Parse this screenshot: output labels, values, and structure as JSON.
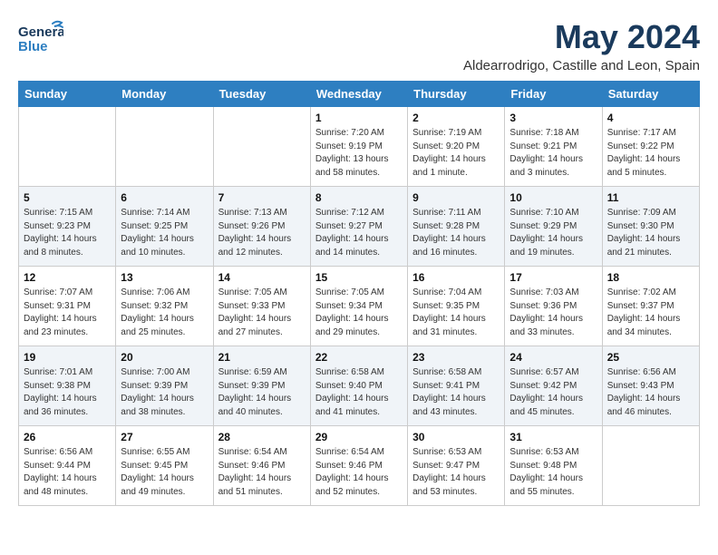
{
  "header": {
    "logo_general": "General",
    "logo_blue": "Blue",
    "month_year": "May 2024",
    "location": "Aldearrodrigo, Castille and Leon, Spain"
  },
  "days_of_week": [
    "Sunday",
    "Monday",
    "Tuesday",
    "Wednesday",
    "Thursday",
    "Friday",
    "Saturday"
  ],
  "weeks": [
    [
      {
        "day": "",
        "info": ""
      },
      {
        "day": "",
        "info": ""
      },
      {
        "day": "",
        "info": ""
      },
      {
        "day": "1",
        "info": "Sunrise: 7:20 AM\nSunset: 9:19 PM\nDaylight: 13 hours\nand 58 minutes."
      },
      {
        "day": "2",
        "info": "Sunrise: 7:19 AM\nSunset: 9:20 PM\nDaylight: 14 hours\nand 1 minute."
      },
      {
        "day": "3",
        "info": "Sunrise: 7:18 AM\nSunset: 9:21 PM\nDaylight: 14 hours\nand 3 minutes."
      },
      {
        "day": "4",
        "info": "Sunrise: 7:17 AM\nSunset: 9:22 PM\nDaylight: 14 hours\nand 5 minutes."
      }
    ],
    [
      {
        "day": "5",
        "info": "Sunrise: 7:15 AM\nSunset: 9:23 PM\nDaylight: 14 hours\nand 8 minutes."
      },
      {
        "day": "6",
        "info": "Sunrise: 7:14 AM\nSunset: 9:25 PM\nDaylight: 14 hours\nand 10 minutes."
      },
      {
        "day": "7",
        "info": "Sunrise: 7:13 AM\nSunset: 9:26 PM\nDaylight: 14 hours\nand 12 minutes."
      },
      {
        "day": "8",
        "info": "Sunrise: 7:12 AM\nSunset: 9:27 PM\nDaylight: 14 hours\nand 14 minutes."
      },
      {
        "day": "9",
        "info": "Sunrise: 7:11 AM\nSunset: 9:28 PM\nDaylight: 14 hours\nand 16 minutes."
      },
      {
        "day": "10",
        "info": "Sunrise: 7:10 AM\nSunset: 9:29 PM\nDaylight: 14 hours\nand 19 minutes."
      },
      {
        "day": "11",
        "info": "Sunrise: 7:09 AM\nSunset: 9:30 PM\nDaylight: 14 hours\nand 21 minutes."
      }
    ],
    [
      {
        "day": "12",
        "info": "Sunrise: 7:07 AM\nSunset: 9:31 PM\nDaylight: 14 hours\nand 23 minutes."
      },
      {
        "day": "13",
        "info": "Sunrise: 7:06 AM\nSunset: 9:32 PM\nDaylight: 14 hours\nand 25 minutes."
      },
      {
        "day": "14",
        "info": "Sunrise: 7:05 AM\nSunset: 9:33 PM\nDaylight: 14 hours\nand 27 minutes."
      },
      {
        "day": "15",
        "info": "Sunrise: 7:05 AM\nSunset: 9:34 PM\nDaylight: 14 hours\nand 29 minutes."
      },
      {
        "day": "16",
        "info": "Sunrise: 7:04 AM\nSunset: 9:35 PM\nDaylight: 14 hours\nand 31 minutes."
      },
      {
        "day": "17",
        "info": "Sunrise: 7:03 AM\nSunset: 9:36 PM\nDaylight: 14 hours\nand 33 minutes."
      },
      {
        "day": "18",
        "info": "Sunrise: 7:02 AM\nSunset: 9:37 PM\nDaylight: 14 hours\nand 34 minutes."
      }
    ],
    [
      {
        "day": "19",
        "info": "Sunrise: 7:01 AM\nSunset: 9:38 PM\nDaylight: 14 hours\nand 36 minutes."
      },
      {
        "day": "20",
        "info": "Sunrise: 7:00 AM\nSunset: 9:39 PM\nDaylight: 14 hours\nand 38 minutes."
      },
      {
        "day": "21",
        "info": "Sunrise: 6:59 AM\nSunset: 9:39 PM\nDaylight: 14 hours\nand 40 minutes."
      },
      {
        "day": "22",
        "info": "Sunrise: 6:58 AM\nSunset: 9:40 PM\nDaylight: 14 hours\nand 41 minutes."
      },
      {
        "day": "23",
        "info": "Sunrise: 6:58 AM\nSunset: 9:41 PM\nDaylight: 14 hours\nand 43 minutes."
      },
      {
        "day": "24",
        "info": "Sunrise: 6:57 AM\nSunset: 9:42 PM\nDaylight: 14 hours\nand 45 minutes."
      },
      {
        "day": "25",
        "info": "Sunrise: 6:56 AM\nSunset: 9:43 PM\nDaylight: 14 hours\nand 46 minutes."
      }
    ],
    [
      {
        "day": "26",
        "info": "Sunrise: 6:56 AM\nSunset: 9:44 PM\nDaylight: 14 hours\nand 48 minutes."
      },
      {
        "day": "27",
        "info": "Sunrise: 6:55 AM\nSunset: 9:45 PM\nDaylight: 14 hours\nand 49 minutes."
      },
      {
        "day": "28",
        "info": "Sunrise: 6:54 AM\nSunset: 9:46 PM\nDaylight: 14 hours\nand 51 minutes."
      },
      {
        "day": "29",
        "info": "Sunrise: 6:54 AM\nSunset: 9:46 PM\nDaylight: 14 hours\nand 52 minutes."
      },
      {
        "day": "30",
        "info": "Sunrise: 6:53 AM\nSunset: 9:47 PM\nDaylight: 14 hours\nand 53 minutes."
      },
      {
        "day": "31",
        "info": "Sunrise: 6:53 AM\nSunset: 9:48 PM\nDaylight: 14 hours\nand 55 minutes."
      },
      {
        "day": "",
        "info": ""
      }
    ]
  ]
}
